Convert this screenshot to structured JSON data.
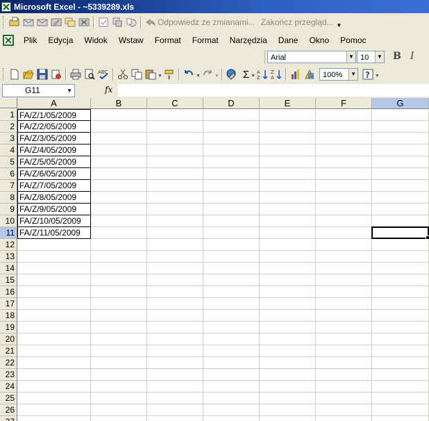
{
  "window": {
    "title": "Microsoft Excel - ~5339289.xls"
  },
  "review_toolbar": {
    "reply_label": "Odpowiedz ze zmianami...",
    "end_review_label": "Zakończ przegląd..."
  },
  "menu": {
    "items": [
      "Plik",
      "Edycja",
      "Widok",
      "Wstaw",
      "Format",
      "Format",
      "Narzędzia",
      "Dane",
      "Okno",
      "Pomoc"
    ]
  },
  "format_toolbar": {
    "font": "Arial",
    "size": "10",
    "bold": "B",
    "italic": "I"
  },
  "standard_toolbar": {
    "autosum": "Σ",
    "zoom": "100%"
  },
  "formula_bar": {
    "name_box": "G11",
    "fx": "fx",
    "formula": ""
  },
  "sheet": {
    "columns": [
      "A",
      "B",
      "C",
      "D",
      "E",
      "F",
      "G"
    ],
    "selected_column": "G",
    "rows": [
      "1",
      "2",
      "3",
      "4",
      "5",
      "6",
      "7",
      "8",
      "9",
      "10",
      "11",
      "12",
      "13",
      "14",
      "15",
      "16",
      "17",
      "18",
      "19",
      "20",
      "21",
      "22",
      "23",
      "24",
      "25",
      "26",
      "27"
    ],
    "selected_row": "11",
    "active_cell": "G11",
    "col_a_values": [
      "FA/Z/1/05/2009",
      "FA/Z/2/05/2009",
      "FA/Z/3/05/2009",
      "FA/Z/4/05/2009",
      "FA/Z/5/05/2009",
      "FA/Z/6/05/2009",
      "FA/Z/7/05/2009",
      "FA/Z/8/05/2009",
      "FA/Z/9/05/2009",
      "FA/Z/10/05/2009",
      "FA/Z/11/05/2009"
    ]
  }
}
